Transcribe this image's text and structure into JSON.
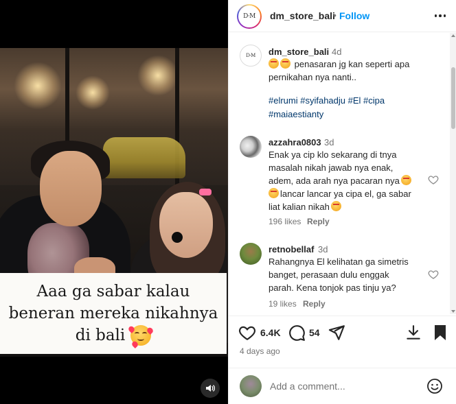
{
  "media": {
    "caption_lines": [
      "Aaa ga sabar kalau",
      "beneran mereka nikahnya",
      "di bali"
    ],
    "emoji": "smiling-face-with-hearts"
  },
  "header": {
    "username": "dm_store_bali",
    "separator": "•",
    "follow_label": "Follow",
    "avatar_text": "D·M"
  },
  "post": {
    "username": "dm_store_bali",
    "time": "4d",
    "text_line1": "penasaran jg kan seperti apa",
    "text_line2": "pernikahan nya nanti..",
    "hashtags_line1": "#elrumi #syifahadju #El #cipa",
    "hashtags_line2": "#maiaestianty"
  },
  "comments": [
    {
      "username": "azzahra0803",
      "time": "3d",
      "lines": [
        "Enak ya cip klo sekarang di tnya",
        "masalah nikah jawab nya enak,",
        "adem, ada arah nya pacaran nya",
        "lancar lancar ya cipa el, ga sabar",
        "liat kalian nikah"
      ],
      "likes": "196 likes",
      "reply_label": "Reply"
    },
    {
      "username": "retnobellaf",
      "time": "3d",
      "lines": [
        "Rahangnya El kelihatan ga simetris",
        "banget, perasaan dulu enggak",
        "parah. Kena tonjok pas tinju ya?"
      ],
      "likes": "19 likes",
      "reply_label": "Reply"
    }
  ],
  "actions": {
    "like_count": "6.4K",
    "comment_count": "54",
    "date": "4 days ago"
  },
  "composer": {
    "placeholder": "Add a comment..."
  },
  "colors": {
    "follow_blue": "#0095f6",
    "hashtag_blue": "#00376b",
    "muted_gray": "#737373"
  }
}
